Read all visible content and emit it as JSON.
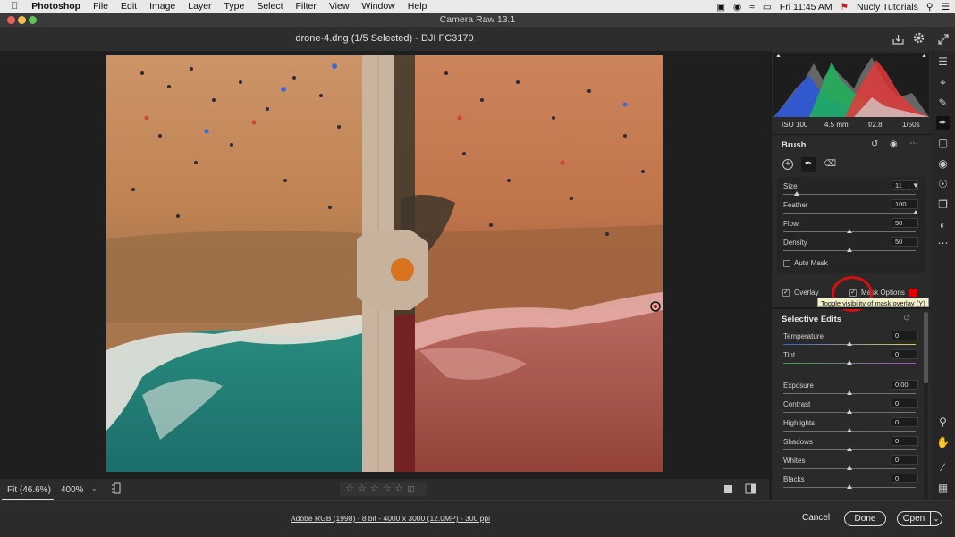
{
  "menubar": {
    "app_name": "Photoshop",
    "items": [
      "File",
      "Edit",
      "Image",
      "Layer",
      "Type",
      "Select",
      "Filter",
      "View",
      "Window",
      "Help"
    ],
    "clock": "Fri 11:45 AM",
    "user": "Nucly Tutorials"
  },
  "window": {
    "title": "Camera Raw 13.1"
  },
  "document": {
    "title": "drone-4.dng (1/5 Selected)  -  DJI FC3170"
  },
  "histogram_info": {
    "iso": "ISO 100",
    "focal": "4.5 mm",
    "aperture": "f/2.8",
    "shutter": "1/50s"
  },
  "brush": {
    "title": "Brush",
    "sliders": [
      {
        "label": "Size",
        "value": "11",
        "pos": 0.1
      },
      {
        "label": "Feather",
        "value": "100",
        "pos": 1.0
      },
      {
        "label": "Flow",
        "value": "50",
        "pos": 0.5
      },
      {
        "label": "Density",
        "value": "50",
        "pos": 0.5
      }
    ],
    "auto_mask": "Auto Mask",
    "overlay": "Overlay",
    "mask_options": "Mask Options",
    "mask_color": "#e00000",
    "tooltip": "Toggle visibility of mask overlay (Y)"
  },
  "selective": {
    "title": "Selective Edits",
    "sliders": [
      {
        "label": "Temperature",
        "value": "0",
        "pos": 0.5
      },
      {
        "label": "Tint",
        "value": "0",
        "pos": 0.5
      },
      {
        "label": "Exposure",
        "value": "0.00",
        "pos": 0.5
      },
      {
        "label": "Contrast",
        "value": "0",
        "pos": 0.5
      },
      {
        "label": "Highlights",
        "value": "0",
        "pos": 0.5
      },
      {
        "label": "Shadows",
        "value": "0",
        "pos": 0.5
      },
      {
        "label": "Whites",
        "value": "0",
        "pos": 0.5
      },
      {
        "label": "Blacks",
        "value": "0",
        "pos": 0.5
      }
    ]
  },
  "viewbar": {
    "fit": "Fit (46.6%)",
    "zoom": "400%",
    "rating_stars": 5
  },
  "footer": {
    "info_link": "Adobe RGB (1998) - 8 bit - 4000 x 3000 (12.0MP) - 300 ppi",
    "cancel": "Cancel",
    "done": "Done",
    "open": "Open"
  },
  "icons": {
    "apple": "apple-icon",
    "search": "search-icon",
    "export": "export-icon",
    "gear": "gear-icon",
    "expand": "expand-icon",
    "reset": "reset-icon",
    "eye": "eye-icon",
    "more": "more-icon",
    "add": "add-icon",
    "brush": "brush-icon",
    "eraser": "eraser-icon"
  }
}
